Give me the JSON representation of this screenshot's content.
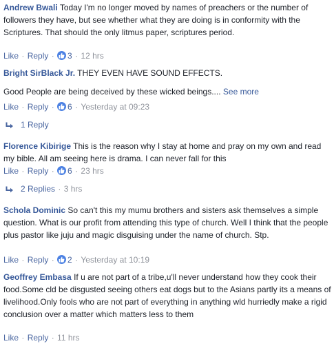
{
  "comments": [
    {
      "author": "Andrew Bwali",
      "text": "Today I'm no longer moved by names of preachers or the number of followers they have, but see whether what they are doing is in conformity with the Scriptures. That should the only litmus paper, scriptures period.",
      "like_label": "Like",
      "reply_label": "Reply",
      "likes": "3",
      "time": "12 hrs"
    },
    {
      "author": "Bright SirBlack Jr.",
      "text": "THEY EVEN HAVE SOUND EFFECTS.",
      "text2": "Good People are being deceived by these wicked beings....",
      "see_more": "See more",
      "like_label": "Like",
      "reply_label": "Reply",
      "likes": "6",
      "time": "Yesterday at 09:23",
      "replies_label": "1 Reply"
    },
    {
      "author": "Florence Kibirige",
      "text": "This is the reason why I stay at home and pray on my own and read my bible. All am seeing here is drama. I can never fall for this",
      "like_label": "Like",
      "reply_label": "Reply",
      "likes": "6",
      "time": "23 hrs",
      "replies_label": "2 Replies",
      "replies_time": "3 hrs"
    },
    {
      "author": "Schola Dominic",
      "text": "So can't this my mumu brothers and sisters ask themselves a simple question. What is our profit from attending this type of church. Well I think that the people plus pastor like juju and magic disguising under the name of church. Stp.",
      "like_label": "Like",
      "reply_label": "Reply",
      "likes": "2",
      "time": "Yesterday at 10:19"
    },
    {
      "author": "Geoffrey Embasa",
      "text": "If u are not part of a tribe,u'll never understand how they cook their food.Some cld be disgusted seeing others eat dogs but to the Asians partly its a means of livelihood.Only fools who are not part of everything in anything wld hurriedly make a rigid conclusion over a matter which matters less to them",
      "like_label": "Like",
      "reply_label": "Reply",
      "time": "11 hrs"
    }
  ],
  "colors": {
    "author": "#365899",
    "link": "#4b67a1",
    "meta": "#90949c",
    "like_badge": "#4d82e3",
    "text": "#1d2129"
  },
  "icons": {
    "like_badge": "thumbs-up-icon",
    "reply_arrow": "reply-arrow-icon"
  }
}
